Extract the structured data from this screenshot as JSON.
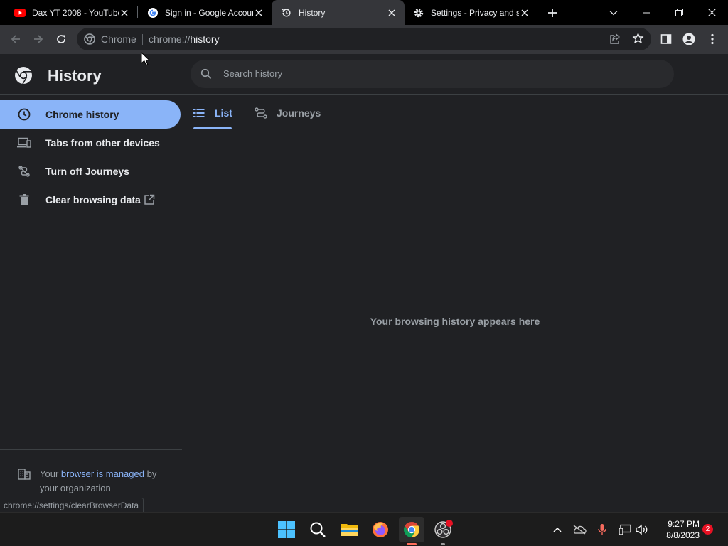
{
  "browser": {
    "tabs": [
      {
        "title": "Dax YT 2008 - YouTube",
        "icon": "youtube-icon"
      },
      {
        "title": "Sign in - Google Accounts",
        "icon": "google-icon"
      },
      {
        "title": "History",
        "icon": "history-icon"
      },
      {
        "title": "Settings - Privacy and security",
        "icon": "settings-gear-icon"
      }
    ],
    "omnibox": {
      "chip": "Chrome",
      "url_scheme": "chrome://",
      "url_host": "history"
    }
  },
  "page": {
    "app_title": "History",
    "search_placeholder": "Search history",
    "sidebar": [
      {
        "label": "Chrome history",
        "icon": "clock-icon",
        "selected": true
      },
      {
        "label": "Tabs from other devices",
        "icon": "devices-icon",
        "selected": false
      },
      {
        "label": "Turn off Journeys",
        "icon": "journeys-off-icon",
        "selected": false
      },
      {
        "label": "Clear browsing data",
        "icon": "trash-icon",
        "selected": false
      }
    ],
    "tabs": [
      {
        "label": "List",
        "selected": true
      },
      {
        "label": "Journeys",
        "selected": false
      }
    ],
    "empty_message": "Your browsing history appears here",
    "managed": {
      "prefix": "Your",
      "link": "browser is managed",
      "suffix": "by",
      "line2": "your organization"
    },
    "status_url": "chrome://settings/clearBrowserData"
  },
  "taskbar": {
    "time": "9:27 PM",
    "date": "8/8/2023",
    "notifications": "2"
  },
  "colors": {
    "accent": "#8ab4f8",
    "background": "#202124",
    "toolbar": "#35363a"
  }
}
